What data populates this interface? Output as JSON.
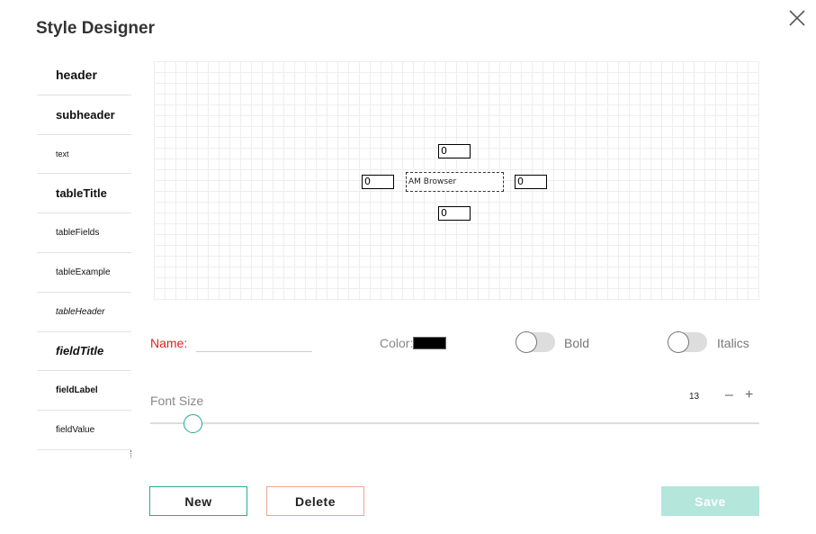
{
  "dialog": {
    "title": "Style Designer"
  },
  "style_list": [
    {
      "label": "header",
      "size": 14,
      "weight": "bold",
      "italic": false
    },
    {
      "label": "subheader",
      "size": 13,
      "weight": "bold",
      "italic": false
    },
    {
      "label": "text",
      "size": 9,
      "weight": "normal",
      "italic": false
    },
    {
      "label": "tableTitle",
      "size": 13,
      "weight": "bold",
      "italic": false
    },
    {
      "label": "tableFields",
      "size": 10,
      "weight": "normal",
      "italic": false
    },
    {
      "label": "tableExample",
      "size": 10,
      "weight": "normal",
      "italic": false
    },
    {
      "label": "tableHeader",
      "size": 10,
      "weight": "normal",
      "italic": true
    },
    {
      "label": "fieldTitle",
      "size": 13,
      "weight": "bold",
      "italic": true
    },
    {
      "label": "fieldLabel",
      "size": 10,
      "weight": "bold",
      "italic": false
    },
    {
      "label": "fieldValue",
      "size": 10,
      "weight": "normal",
      "italic": false
    }
  ],
  "preview": {
    "text": "AM Browser",
    "padding_top": "0",
    "padding_left": "0",
    "padding_right": "0",
    "padding_bottom": "0"
  },
  "form": {
    "name_label": "Name:",
    "name_value": "",
    "color_label": "Color:",
    "color_value": "#000000",
    "bold_label": "Bold",
    "bold_on": false,
    "italics_label": "Italics",
    "italics_on": false,
    "font_size_label": "Font Size",
    "font_size_value": "13",
    "minus_symbol": "–",
    "plus_symbol": "+"
  },
  "buttons": {
    "new_label": "New",
    "delete_label": "Delete",
    "save_label": "Save"
  },
  "colors": {
    "accent": "#2fa898",
    "delete_border": "#f0a58f",
    "save_disabled": "#b4e6dc",
    "name_label": "#e02020"
  },
  "icons": {
    "close": "close-icon"
  }
}
